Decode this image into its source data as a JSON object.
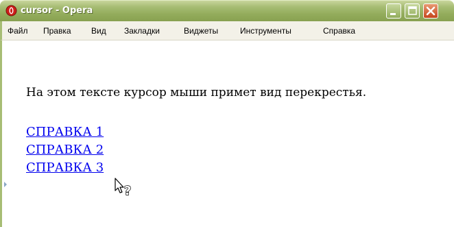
{
  "window": {
    "title": "cursor - Opera",
    "controls": [
      "minimize-icon",
      "maximize-icon",
      "close-icon"
    ]
  },
  "menubar": {
    "items": [
      {
        "label": "Файл"
      },
      {
        "label": "Правка"
      },
      {
        "label": "Вид"
      },
      {
        "label": "Закладки"
      },
      {
        "label": "Виджеты"
      },
      {
        "label": "Инструменты"
      },
      {
        "label": "Справка"
      }
    ]
  },
  "content": {
    "paragraph": "На этом тексте курсор мыши примет вид перекрестья.",
    "links": [
      {
        "label": "СПРАВКА 1"
      },
      {
        "label": "СПРАВКА 2"
      },
      {
        "label": "СПРАВКА 3"
      }
    ],
    "cursor_icon": "help-cursor-icon"
  },
  "colors": {
    "titlebar": "#93ac5c",
    "title_text": "#ffffff",
    "close_button": "#c5461d",
    "menubar_bg": "#f3f1e8",
    "link": "#0000ee"
  }
}
